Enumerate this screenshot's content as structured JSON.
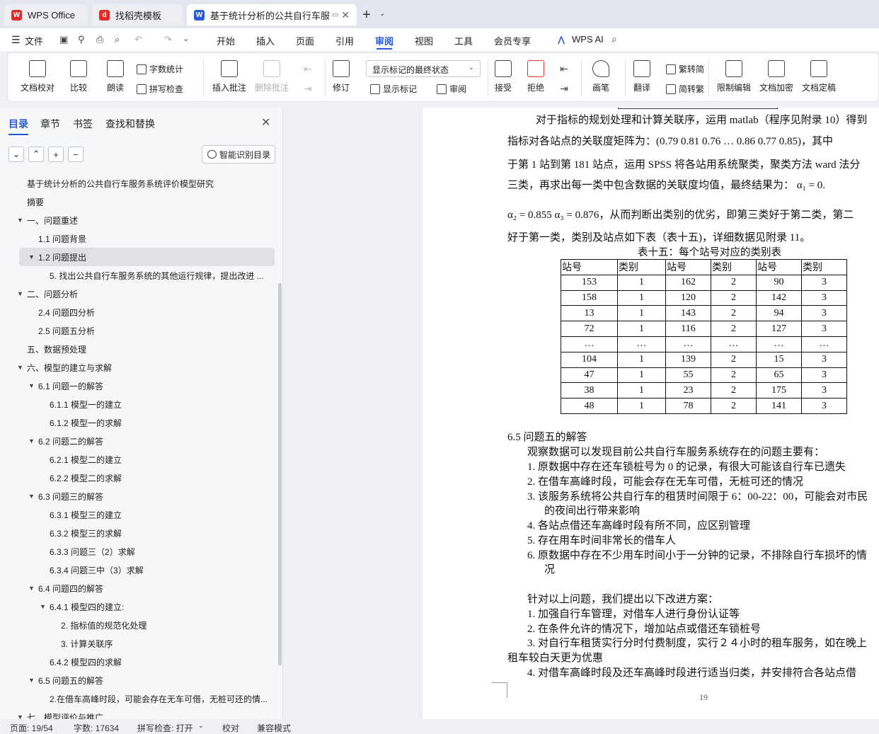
{
  "tabs": [
    {
      "label": "WPS Office",
      "icon": "wps-logo-icon",
      "color": "#e02b2b"
    },
    {
      "label": "找稻壳模板",
      "icon": "docer-icon",
      "color": "#e02b2b"
    },
    {
      "label": "基于统计分析的公共自行车服务",
      "icon": "word-doc-icon",
      "color": "#2a5bd7"
    }
  ],
  "menu": {
    "file": "文件",
    "items": [
      "开始",
      "插入",
      "页面",
      "引用",
      "审阅",
      "视图",
      "工具",
      "会员专享"
    ],
    "active": "审阅",
    "ai": "WPS AI"
  },
  "ribbon": {
    "doc_check": "文档校对",
    "compare": "比较",
    "read_aloud": "朗读",
    "word_count": "字数统计",
    "spell_check": "拼写检查",
    "insert_comment": "插入批注",
    "delete_comment": "删除批注",
    "revise": "修订",
    "markup_state": "显示标记的最终状态",
    "show_markup": "显示标记",
    "review_pane": "审阅",
    "accept": "接受",
    "reject": "拒绝",
    "pen": "画笔",
    "translate": "翻译",
    "to_simplified": "繁转简",
    "to_traditional": "简转繁",
    "restrict_edit": "限制编辑",
    "encrypt": "文档加密",
    "finalize": "文档定稿"
  },
  "panel": {
    "tabs": [
      "目录",
      "章节",
      "书签",
      "查找和替换"
    ],
    "active_tab": "目录",
    "smart_button": "智能识别目录",
    "toc": [
      {
        "label": "基于统计分析的公共自行车服务系统评价模型研究",
        "level": 0
      },
      {
        "label": "摘要",
        "level": 0
      },
      {
        "label": "一、问题重述",
        "level": 0,
        "caret": "▼"
      },
      {
        "label": "1.1 问题背景",
        "level": 1
      },
      {
        "label": "1.2 问题提出",
        "level": 1,
        "caret": "▼",
        "selected": true
      },
      {
        "label": "5. 找出公共自行车服务系统的其他运行规律，提出改进 ...",
        "level": 2
      },
      {
        "label": "二、问题分析",
        "level": 0,
        "caret": "▼"
      },
      {
        "label": "2.4 问题四分析",
        "level": 1
      },
      {
        "label": "2.5 问题五分析",
        "level": 1
      },
      {
        "label": "五、数据预处理",
        "level": 0
      },
      {
        "label": "六、模型的建立与求解",
        "level": 0,
        "caret": "▼"
      },
      {
        "label": "6.1 问题一的解答",
        "level": 1,
        "caret": "▼"
      },
      {
        "label": "6.1.1 模型一的建立",
        "level": 2
      },
      {
        "label": "6.1.2 模型一的求解",
        "level": 2
      },
      {
        "label": "6.2 问题二的解答",
        "level": 1,
        "caret": "▼"
      },
      {
        "label": "6.2.1 模型二的建立",
        "level": 2
      },
      {
        "label": "6.2.2 模型二的求解",
        "level": 2
      },
      {
        "label": "6.3 问题三的解答",
        "level": 1,
        "caret": "▼"
      },
      {
        "label": "6.3.1 模型三的建立",
        "level": 2
      },
      {
        "label": "6.3.2 模型三的求解",
        "level": 2
      },
      {
        "label": "6.3.3  问题三（2）求解",
        "level": 2
      },
      {
        "label": "6.3.4  问题三中（3）求解",
        "level": 2
      },
      {
        "label": "6.4 问题四的解答",
        "level": 1,
        "caret": "▼"
      },
      {
        "label": "6.4.1 模型四的建立:",
        "level": 2,
        "caret": "▼"
      },
      {
        "label": "2. 指标值的规范化处理",
        "level": 3
      },
      {
        "label": "3. 计算关联序",
        "level": 3
      },
      {
        "label": "6.4.2 模型四的求解",
        "level": 2
      },
      {
        "label": "6.5 问题五的解答",
        "level": 1,
        "caret": "▼"
      },
      {
        "label": "2.在借车高峰时段，可能会存在无车可借，无桩可还的情...",
        "level": 2
      },
      {
        "label": "七、模型评价与推广",
        "level": 0,
        "caret": "▼"
      }
    ]
  },
  "document": {
    "lines": [
      "对于指标的规划处理和计算关联序，运用 matlab（程序见附录 10）得到",
      "指标对各站点的关联度矩阵为：(0.79   0.81  0.76   …   0.86  0.77   0.85)，其中",
      "于第 1 站到第 181 站点，运用 SPSS 将各站用系统聚类，聚类方法 ward 法分",
      "三类，再求出每一类中包含数据的关联度均值，最终结果为：  α₁ = 0.",
      "α₂ = 0.855   α₃ = 0.876，从而判断出类别的优劣，即第三类好于第二类，第二",
      "好于第一类，类别及站点如下表（表十五)，详细数据见附录 11。"
    ],
    "table_caption": "表十五：每个站号对应的类别表",
    "table_header": [
      "站号",
      "类别",
      "站号",
      "类别",
      "站号",
      "类别"
    ],
    "table_rows": [
      [
        "153",
        "1",
        "162",
        "2",
        "90",
        "3"
      ],
      [
        "158",
        "1",
        "120",
        "2",
        "142",
        "3"
      ],
      [
        "13",
        "1",
        "143",
        "2",
        "94",
        "3"
      ],
      [
        "72",
        "1",
        "116",
        "2",
        "127",
        "3"
      ],
      [
        "…",
        "…",
        "…",
        "…",
        "…",
        "…"
      ],
      [
        "104",
        "1",
        "139",
        "2",
        "15",
        "3"
      ],
      [
        "47",
        "1",
        "55",
        "2",
        "65",
        "3"
      ],
      [
        "38",
        "1",
        "23",
        "2",
        "175",
        "3"
      ],
      [
        "48",
        "1",
        "78",
        "2",
        "141",
        "3"
      ]
    ],
    "section_heading": "6.5 问题五的解答",
    "problems_intro": "观察数据可以发现目前公共自行车服务系统存在的问题主要有：",
    "problems": [
      "1.   原数据中存在还车锁桩号为 0 的记录，有很大可能该自行车已遗失",
      "2.   在借车高峰时段，可能会存在无车可借，无桩可还的情况",
      "3.   该服务系统将公共自行车的租赁时间限于 6：00-22：00，可能会对市民",
      "的夜间出行带来影响",
      "4.   各站点借还车高峰时段有所不同，应区别管理",
      "5.   存在用车时间非常长的借车人",
      "6.   原数据中存在不少用车时间小于一分钟的记录，不排除自行车损坏的情",
      "况"
    ],
    "solutions_intro": "针对以上问题，我们提出以下改进方案：",
    "solutions": [
      "1.    加强自行车管理，对借车人进行身份认证等",
      "2.    在条件允许的情况下，增加站点或借还车锁桩号",
      "3.    对自行车租赁实行分时付费制度，实行２４小时的租车服务，如在晚上",
      "租车较白天更为优惠",
      "4.    对借车高峰时段及还车高峰时段进行适当归类，并安排符合各站点借"
    ],
    "page_number": "19"
  },
  "status": {
    "page": "页面: 19/54",
    "words": "字数: 17634",
    "spell": "拼写检查: 打开",
    "proof": "校对",
    "compat": "兼容模式"
  },
  "colors": {
    "accent": "#2a58d8",
    "wps_red": "#e02b2b"
  }
}
